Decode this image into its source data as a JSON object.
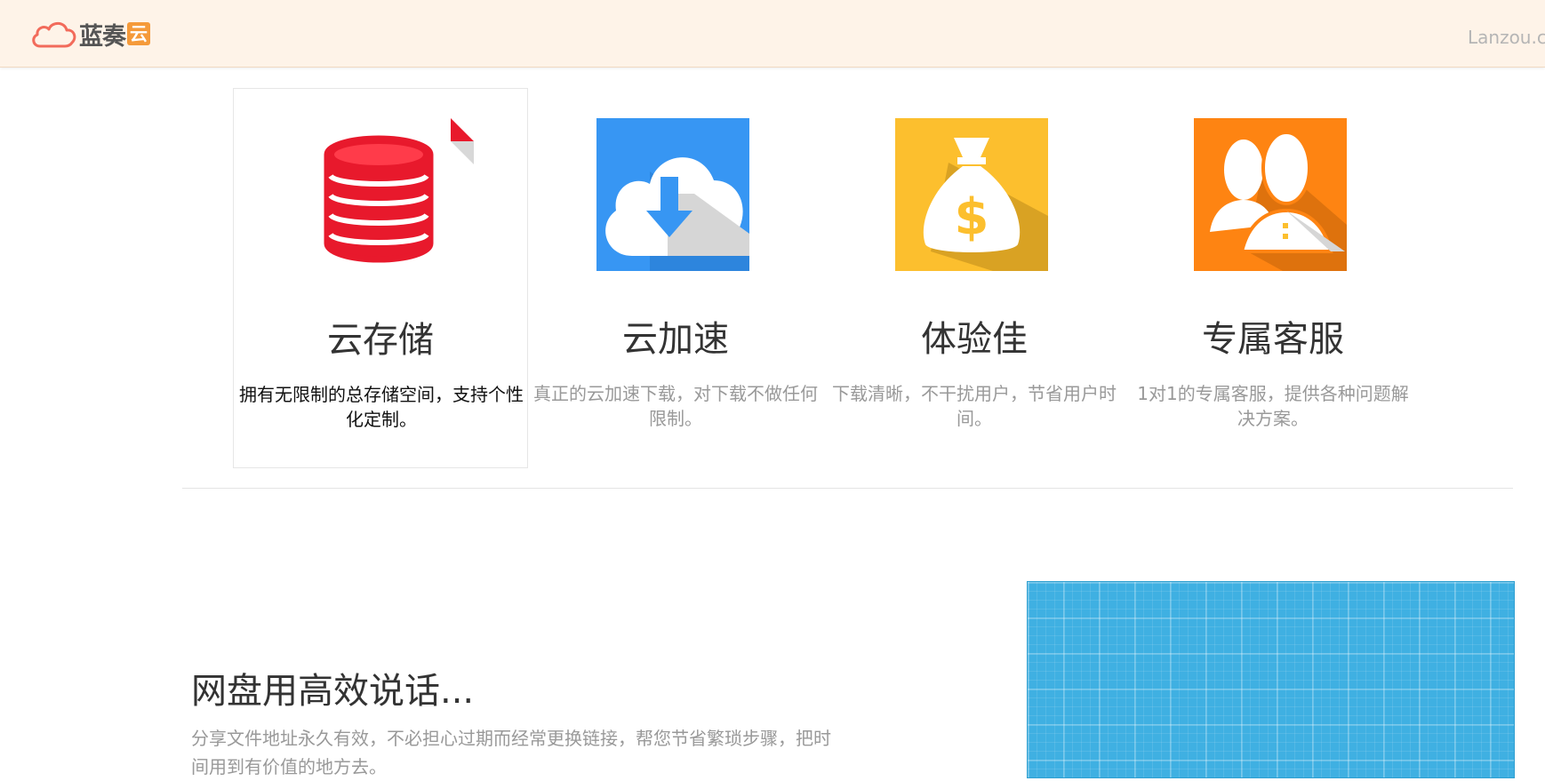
{
  "header": {
    "logo_text": "蓝奏",
    "logo_badge": "云",
    "brand_right": "Lanzou.com"
  },
  "features": [
    {
      "title": "云存储",
      "desc": "拥有无限制的总存储空间，支持个性化定制。",
      "icon": "database-stack-icon",
      "color": "#e8192c"
    },
    {
      "title": "云加速",
      "desc": "真正的云加速下载，对下载不做任何限制。",
      "icon": "cloud-download-icon",
      "color": "#3796f3"
    },
    {
      "title": "体验佳",
      "desc": "下载清晰，不干扰用户，节省用户时间。",
      "icon": "money-bag-icon",
      "color": "#fcbf2e"
    },
    {
      "title": "专属客服",
      "desc": "1对1的专属客服，提供各种问题解决方案。",
      "icon": "users-support-icon",
      "color": "#fe8412"
    }
  ],
  "promo": {
    "title": "网盘用高效说话...",
    "desc": "分享文件地址永久有效，不必担心过期而经常更换链接，帮您节省繁琐步骤，把时间用到有价值的地方去。"
  },
  "colors": {
    "header_bg": "#fef3e8",
    "pattern_bg": "#3fb0e2"
  }
}
